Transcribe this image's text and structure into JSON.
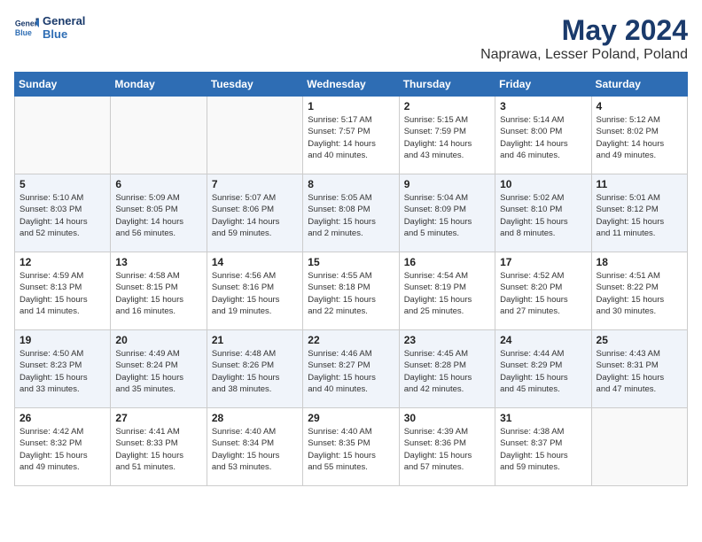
{
  "header": {
    "logo_line1": "General",
    "logo_line2": "Blue",
    "title": "May 2024",
    "subtitle": "Naprawa, Lesser Poland, Poland"
  },
  "days_of_week": [
    "Sunday",
    "Monday",
    "Tuesday",
    "Wednesday",
    "Thursday",
    "Friday",
    "Saturday"
  ],
  "weeks": [
    [
      {
        "day": "",
        "info": ""
      },
      {
        "day": "",
        "info": ""
      },
      {
        "day": "",
        "info": ""
      },
      {
        "day": "1",
        "info": "Sunrise: 5:17 AM\nSunset: 7:57 PM\nDaylight: 14 hours\nand 40 minutes."
      },
      {
        "day": "2",
        "info": "Sunrise: 5:15 AM\nSunset: 7:59 PM\nDaylight: 14 hours\nand 43 minutes."
      },
      {
        "day": "3",
        "info": "Sunrise: 5:14 AM\nSunset: 8:00 PM\nDaylight: 14 hours\nand 46 minutes."
      },
      {
        "day": "4",
        "info": "Sunrise: 5:12 AM\nSunset: 8:02 PM\nDaylight: 14 hours\nand 49 minutes."
      }
    ],
    [
      {
        "day": "5",
        "info": "Sunrise: 5:10 AM\nSunset: 8:03 PM\nDaylight: 14 hours\nand 52 minutes."
      },
      {
        "day": "6",
        "info": "Sunrise: 5:09 AM\nSunset: 8:05 PM\nDaylight: 14 hours\nand 56 minutes."
      },
      {
        "day": "7",
        "info": "Sunrise: 5:07 AM\nSunset: 8:06 PM\nDaylight: 14 hours\nand 59 minutes."
      },
      {
        "day": "8",
        "info": "Sunrise: 5:05 AM\nSunset: 8:08 PM\nDaylight: 15 hours\nand 2 minutes."
      },
      {
        "day": "9",
        "info": "Sunrise: 5:04 AM\nSunset: 8:09 PM\nDaylight: 15 hours\nand 5 minutes."
      },
      {
        "day": "10",
        "info": "Sunrise: 5:02 AM\nSunset: 8:10 PM\nDaylight: 15 hours\nand 8 minutes."
      },
      {
        "day": "11",
        "info": "Sunrise: 5:01 AM\nSunset: 8:12 PM\nDaylight: 15 hours\nand 11 minutes."
      }
    ],
    [
      {
        "day": "12",
        "info": "Sunrise: 4:59 AM\nSunset: 8:13 PM\nDaylight: 15 hours\nand 14 minutes."
      },
      {
        "day": "13",
        "info": "Sunrise: 4:58 AM\nSunset: 8:15 PM\nDaylight: 15 hours\nand 16 minutes."
      },
      {
        "day": "14",
        "info": "Sunrise: 4:56 AM\nSunset: 8:16 PM\nDaylight: 15 hours\nand 19 minutes."
      },
      {
        "day": "15",
        "info": "Sunrise: 4:55 AM\nSunset: 8:18 PM\nDaylight: 15 hours\nand 22 minutes."
      },
      {
        "day": "16",
        "info": "Sunrise: 4:54 AM\nSunset: 8:19 PM\nDaylight: 15 hours\nand 25 minutes."
      },
      {
        "day": "17",
        "info": "Sunrise: 4:52 AM\nSunset: 8:20 PM\nDaylight: 15 hours\nand 27 minutes."
      },
      {
        "day": "18",
        "info": "Sunrise: 4:51 AM\nSunset: 8:22 PM\nDaylight: 15 hours\nand 30 minutes."
      }
    ],
    [
      {
        "day": "19",
        "info": "Sunrise: 4:50 AM\nSunset: 8:23 PM\nDaylight: 15 hours\nand 33 minutes."
      },
      {
        "day": "20",
        "info": "Sunrise: 4:49 AM\nSunset: 8:24 PM\nDaylight: 15 hours\nand 35 minutes."
      },
      {
        "day": "21",
        "info": "Sunrise: 4:48 AM\nSunset: 8:26 PM\nDaylight: 15 hours\nand 38 minutes."
      },
      {
        "day": "22",
        "info": "Sunrise: 4:46 AM\nSunset: 8:27 PM\nDaylight: 15 hours\nand 40 minutes."
      },
      {
        "day": "23",
        "info": "Sunrise: 4:45 AM\nSunset: 8:28 PM\nDaylight: 15 hours\nand 42 minutes."
      },
      {
        "day": "24",
        "info": "Sunrise: 4:44 AM\nSunset: 8:29 PM\nDaylight: 15 hours\nand 45 minutes."
      },
      {
        "day": "25",
        "info": "Sunrise: 4:43 AM\nSunset: 8:31 PM\nDaylight: 15 hours\nand 47 minutes."
      }
    ],
    [
      {
        "day": "26",
        "info": "Sunrise: 4:42 AM\nSunset: 8:32 PM\nDaylight: 15 hours\nand 49 minutes."
      },
      {
        "day": "27",
        "info": "Sunrise: 4:41 AM\nSunset: 8:33 PM\nDaylight: 15 hours\nand 51 minutes."
      },
      {
        "day": "28",
        "info": "Sunrise: 4:40 AM\nSunset: 8:34 PM\nDaylight: 15 hours\nand 53 minutes."
      },
      {
        "day": "29",
        "info": "Sunrise: 4:40 AM\nSunset: 8:35 PM\nDaylight: 15 hours\nand 55 minutes."
      },
      {
        "day": "30",
        "info": "Sunrise: 4:39 AM\nSunset: 8:36 PM\nDaylight: 15 hours\nand 57 minutes."
      },
      {
        "day": "31",
        "info": "Sunrise: 4:38 AM\nSunset: 8:37 PM\nDaylight: 15 hours\nand 59 minutes."
      },
      {
        "day": "",
        "info": ""
      }
    ]
  ]
}
